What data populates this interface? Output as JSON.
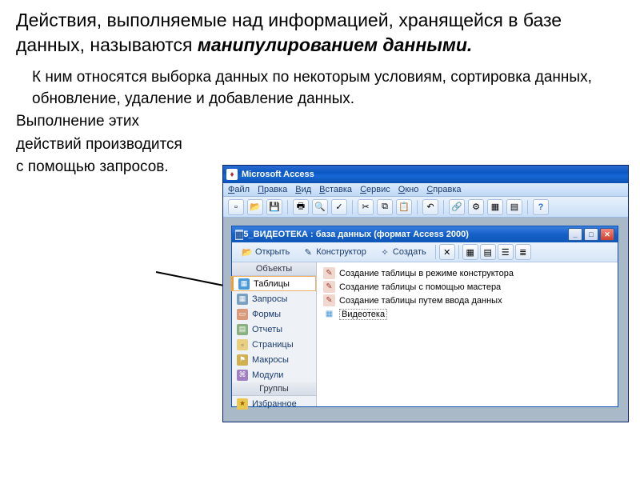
{
  "heading": {
    "line1": "Действия, выполняемые над информацией, хранящейся в базе данных, называются ",
    "bold": "манипулированием данными."
  },
  "body": {
    "p1": "К ним относятся выборка данных по некоторым условиям, сортировка данных, обновление, удаление и добавление данных.",
    "p2": "Выполнение этих",
    "p3": "действий производится",
    "p4": "с помощью запросов."
  },
  "access": {
    "app_title": "Microsoft Access",
    "menu": [
      "Файл",
      "Правка",
      "Вид",
      "Вставка",
      "Сервис",
      "Окно",
      "Справка"
    ],
    "db_title": "5_ВИДЕОТЕКА : база данных (формат Access 2000)",
    "db_toolbar": {
      "open": "Открыть",
      "design": "Конструктор",
      "create": "Создать"
    },
    "nav": {
      "objects_header": "Объекты",
      "items": [
        {
          "label": "Таблицы"
        },
        {
          "label": "Запросы"
        },
        {
          "label": "Формы"
        },
        {
          "label": "Отчеты"
        },
        {
          "label": "Страницы"
        },
        {
          "label": "Макросы"
        },
        {
          "label": "Модули"
        }
      ],
      "groups_header": "Группы",
      "favorites": "Избранное"
    },
    "content": {
      "items": [
        {
          "label": "Создание таблицы в режиме конструктора"
        },
        {
          "label": "Создание таблицы с помощью мастера"
        },
        {
          "label": "Создание таблицы путем ввода данных"
        },
        {
          "label": "Видеотека"
        }
      ]
    }
  }
}
